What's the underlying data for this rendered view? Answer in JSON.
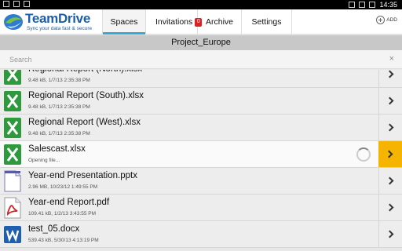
{
  "status_bar": {
    "time": "14:35",
    "left_icons": [
      "image-icon",
      "usb-icon",
      "download-icon"
    ],
    "right_icons": [
      "no-sim-icon",
      "wifi-icon",
      "battery-icon"
    ]
  },
  "app": {
    "name": "TeamDrive",
    "tagline": "Sync your data fast & secure"
  },
  "tabs": [
    {
      "label": "Spaces",
      "active": true
    },
    {
      "label": "Invitations",
      "badge": "0"
    },
    {
      "label": "Archive"
    },
    {
      "label": "Settings"
    }
  ],
  "add_label": "ADD",
  "space_title": "Project_Europe",
  "search": {
    "placeholder": "Search",
    "value": "",
    "clear_icon": "close-icon"
  },
  "files": [
    {
      "name": "Regional Report (North).xlsx",
      "meta": "9.48 kB, 1/7/13 2:35:38 PM",
      "icon": "xlsx-icon"
    },
    {
      "name": "Regional Report (South).xlsx",
      "meta": "9.48 kB, 1/7/13 2:35:38 PM",
      "icon": "xlsx-icon"
    },
    {
      "name": "Regional Report (West).xlsx",
      "meta": "9.48 kB, 1/7/13 2:35:38 PM",
      "icon": "xlsx-icon"
    },
    {
      "name": "Salescast.xlsx",
      "meta": "Opening file...",
      "icon": "xlsx-icon",
      "selected": true
    },
    {
      "name": "Year-end Presentation.pptx",
      "meta": "2.96 MB, 10/23/12 1:49:55 PM",
      "icon": "pptx-icon"
    },
    {
      "name": "Year-end Report.pdf",
      "meta": "109.41 kB, 1/2/13 3:43:55 PM",
      "icon": "pdf-icon"
    },
    {
      "name": "test_05.docx",
      "meta": "539.43 kB, 5/30/13 4:13:19 PM",
      "icon": "docx-icon"
    }
  ],
  "colors": {
    "brand": "#1e5ea8",
    "accent": "#35a9d6",
    "selected_action": "#f5b400",
    "badge": "#e02020"
  }
}
